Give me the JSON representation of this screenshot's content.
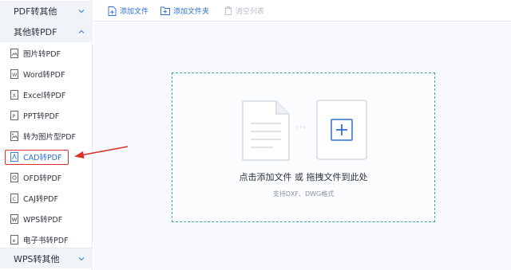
{
  "sidebar": {
    "group_pdf_to_other": "PDF转其他",
    "group_other_to_pdf": "其他转PDF",
    "group_wps_to_other": "WPS转其他",
    "items": [
      {
        "label": "图片转PDF",
        "icon": "image-file-icon"
      },
      {
        "label": "Word转PDF",
        "icon": "word-file-icon"
      },
      {
        "label": "Excel转PDF",
        "icon": "excel-file-icon"
      },
      {
        "label": "PPT转PDF",
        "icon": "ppt-file-icon"
      },
      {
        "label": "转为图片型PDF",
        "icon": "image-pdf-icon"
      },
      {
        "label": "CAD转PDF",
        "icon": "cad-file-icon",
        "active": true
      },
      {
        "label": "OFD转PDF",
        "icon": "ofd-file-icon"
      },
      {
        "label": "CAJ转PDF",
        "icon": "caj-file-icon"
      },
      {
        "label": "WPS转PDF",
        "icon": "wps-file-icon"
      },
      {
        "label": "电子书转PDF",
        "icon": "ebook-file-icon"
      }
    ]
  },
  "toolbar": {
    "add_file": "添加文件",
    "add_folder": "添加文件夹",
    "clear_list": "清空列表"
  },
  "dropzone": {
    "title": "点击添加文件 或 拖拽文件到此处",
    "subtitle": "支持DXF、DWG格式",
    "arrows": "›››"
  },
  "colors": {
    "accent": "#2d6fd2",
    "highlight_red": "#d9312b",
    "dashed_border": "#3ea8a0"
  }
}
